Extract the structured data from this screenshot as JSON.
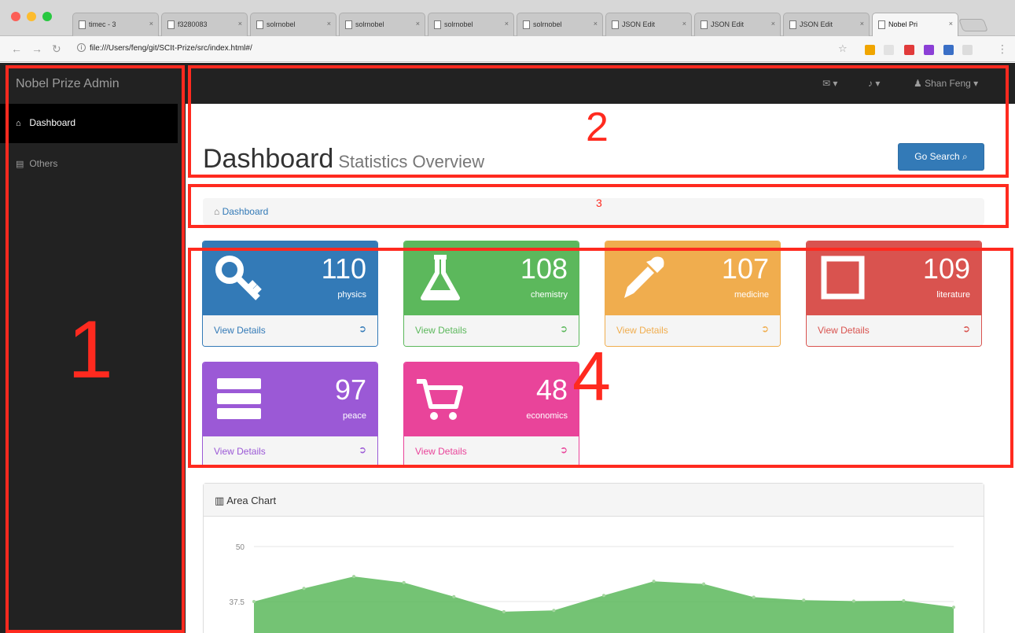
{
  "browser": {
    "tabs": [
      {
        "title": "timec - 3"
      },
      {
        "title": "f3280083"
      },
      {
        "title": "solrnobel"
      },
      {
        "title": "solrnobel"
      },
      {
        "title": "solrnobel"
      },
      {
        "title": "solrnobel"
      },
      {
        "title": "JSON Edit"
      },
      {
        "title": "JSON Edit"
      },
      {
        "title": "JSON Edit"
      },
      {
        "title": "Nobel Pri"
      }
    ],
    "url": "file:///Users/feng/git/SCIt-Prize/src/index.html#/",
    "close_glyph": "×"
  },
  "sidebar": {
    "brand": "Nobel Prize Admin",
    "items": [
      {
        "label": "Dashboard",
        "icon": "dashboard-icon",
        "active": true
      },
      {
        "label": "Others",
        "icon": "file-icon",
        "active": false
      }
    ]
  },
  "topnav": {
    "messages_icon": "envelope-icon",
    "alerts_icon": "bell-icon",
    "user_label": "Shan Feng",
    "caret": "▾"
  },
  "header": {
    "title": "Dashboard",
    "subtitle": "Statistics Overview",
    "search_button": "Go Search"
  },
  "breadcrumb": {
    "label": "Dashboard"
  },
  "cards": [
    {
      "number": "110",
      "label": "physics",
      "link": "View Details",
      "color": "#337ab7",
      "icon": "key-icon"
    },
    {
      "number": "108",
      "label": "chemistry",
      "link": "View Details",
      "color": "#5cb85c",
      "icon": "flask-icon"
    },
    {
      "number": "107",
      "label": "medicine",
      "link": "View Details",
      "color": "#f0ad4e",
      "icon": "eyedropper-icon"
    },
    {
      "number": "109",
      "label": "literature",
      "link": "View Details",
      "color": "#d9534f",
      "icon": "square-icon"
    },
    {
      "number": "97",
      "label": "peace",
      "link": "View Details",
      "color": "#9b59d6",
      "icon": "server-icon"
    },
    {
      "number": "48",
      "label": "economics",
      "link": "View Details",
      "color": "#e9449a",
      "icon": "cart-icon"
    }
  ],
  "area_chart": {
    "title": "Area Chart",
    "chart_data": {
      "type": "area",
      "y_ticks": [
        "50",
        "37.5"
      ],
      "values": [
        37.5,
        40.5,
        43.2,
        41.8,
        38.6,
        35.2,
        35.5,
        38.9,
        42.1,
        41.5,
        38.5,
        37.8,
        37.6,
        37.7,
        36.2
      ],
      "ylim": [
        30,
        50
      ],
      "color": "#5cb85c"
    }
  },
  "annotations": [
    "1",
    "2",
    "3",
    "4"
  ],
  "colors": {
    "sidebar": "#222222",
    "primary": "#337ab7",
    "annotation": "#ff2a1f"
  }
}
